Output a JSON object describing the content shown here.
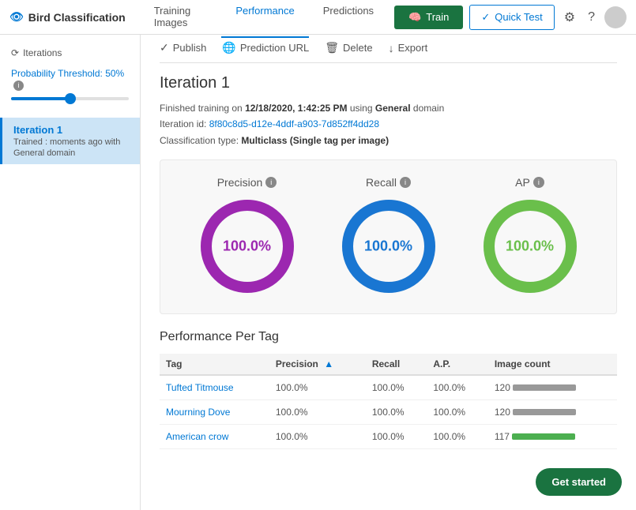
{
  "app": {
    "title": "Bird Classification",
    "eye_icon": "👁"
  },
  "nav": {
    "tabs": [
      {
        "id": "training-images",
        "label": "Training Images",
        "active": false
      },
      {
        "id": "performance",
        "label": "Performance",
        "active": true
      },
      {
        "id": "predictions",
        "label": "Predictions",
        "active": false
      }
    ],
    "train_button": "Train",
    "quick_test_button": "Quick Test"
  },
  "sidebar": {
    "iterations_label": "Iterations",
    "probability_label": "Probability Threshold:",
    "probability_value": "50%",
    "iteration": {
      "title": "Iteration 1",
      "trained_label": "Trained : moments ago with",
      "domain": "General domain"
    }
  },
  "toolbar": {
    "publish": "Publish",
    "prediction_url": "Prediction URL",
    "delete": "Delete",
    "export": "Export"
  },
  "iteration": {
    "title": "Iteration 1",
    "train_date": "12/18/2020, 1:42:25 PM",
    "domain": "General",
    "iteration_id": "8f80c8d5-d12e-4ddf-a903-7d852ff4dd28",
    "classification_type": "Multiclass (Single tag per image)"
  },
  "metrics": {
    "precision": {
      "label": "Precision",
      "value": "100.0%",
      "color": "#9c27b0"
    },
    "recall": {
      "label": "Recall",
      "value": "100.0%",
      "color": "#1976d2"
    },
    "ap": {
      "label": "AP",
      "value": "100.0%",
      "color": "#6abf4b"
    }
  },
  "performance_per_tag": {
    "title": "Performance Per Tag",
    "columns": {
      "tag": "Tag",
      "precision": "Precision",
      "recall": "Recall",
      "ap": "A.P.",
      "image_count": "Image count"
    },
    "rows": [
      {
        "tag": "Tufted Titmouse",
        "precision": "100.0%",
        "recall": "100.0%",
        "ap": "100.0%",
        "image_count": "120",
        "bar_type": "gray"
      },
      {
        "tag": "Mourning Dove",
        "precision": "100.0%",
        "recall": "100.0%",
        "ap": "100.0%",
        "image_count": "120",
        "bar_type": "gray"
      },
      {
        "tag": "American crow",
        "precision": "100.0%",
        "recall": "100.0%",
        "ap": "100.0%",
        "image_count": "117",
        "bar_type": "green"
      }
    ]
  },
  "get_started": "Get started"
}
